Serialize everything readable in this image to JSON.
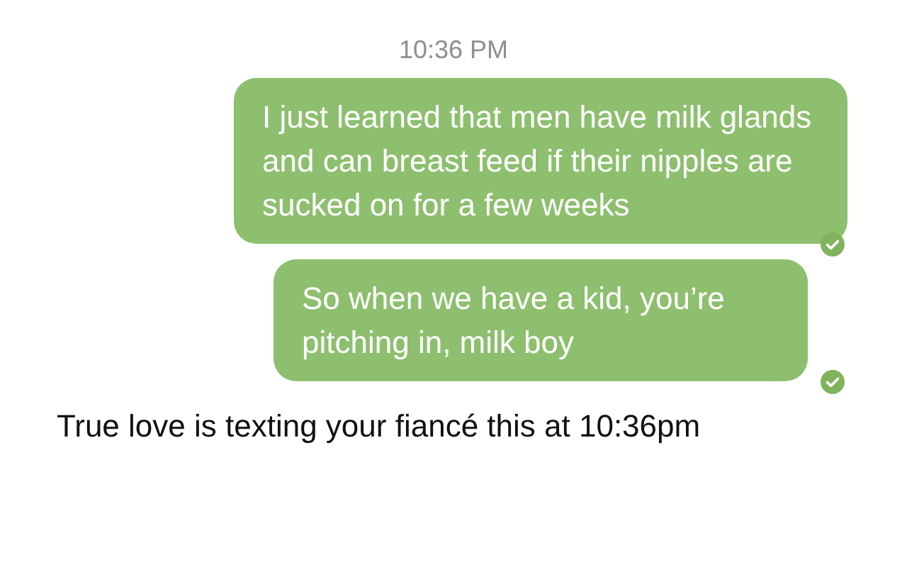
{
  "timestamp": "10:36 PM",
  "messages": [
    {
      "text": "I just learned that men have milk glands and can breast feed if their nipples are sucked on for a few weeks",
      "delivered": true
    },
    {
      "text": "So when we have a kid, you’re pitching in, milk boy",
      "delivered": true
    }
  ],
  "caption": "True love is texting your fiancé this at 10:36pm"
}
